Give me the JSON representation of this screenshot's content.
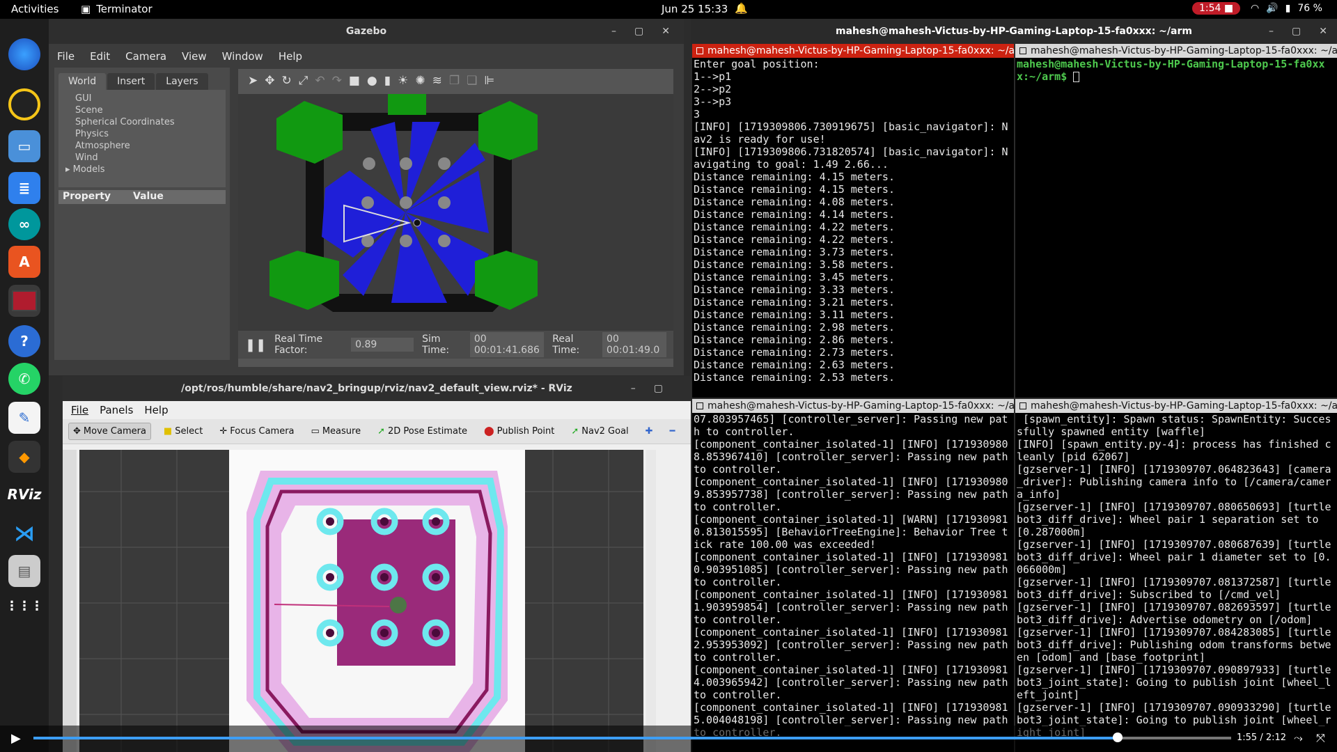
{
  "topbar": {
    "activities": "Activities",
    "app": "Terminator",
    "clock": "Jun 25  15:33",
    "rec": "1:54",
    "battery": "76 %"
  },
  "dock": {
    "items": [
      "firefox-icon",
      "rhythmbox-icon",
      "files-icon",
      "writer-icon",
      "arduino-icon",
      "app-center-icon",
      "terminator-icon",
      "help-icon",
      "whatsapp-icon",
      "text-editor-icon",
      "sublime-icon",
      "rviz-icon",
      "vscode-icon",
      "disk-icon",
      "show-apps-icon"
    ]
  },
  "gazebo": {
    "title": "Gazebo",
    "menu": [
      "File",
      "Edit",
      "Camera",
      "View",
      "Window",
      "Help"
    ],
    "tabs": [
      "World",
      "Insert",
      "Layers"
    ],
    "tree": [
      "GUI",
      "Scene",
      "Spherical Coordinates",
      "Physics",
      "Atmosphere",
      "Wind",
      "Models"
    ],
    "prop_header": "Property",
    "value_header": "Value",
    "rtf_label": "Real Time Factor:",
    "rtf": "0.89",
    "sim_label": "Sim Time:",
    "sim": "00 00:01:41.686",
    "real_label": "Real Time:",
    "real": "00 00:01:49.0"
  },
  "rviz": {
    "title": "/opt/ros/humble/share/nav2_bringup/rviz/nav2_default_view.rviz* - RViz",
    "menu": [
      "File",
      "Panels",
      "Help"
    ],
    "tools": [
      "Move Camera",
      "Select",
      "Focus Camera",
      "Measure",
      "2D Pose Estimate",
      "Publish Point",
      "Nav2 Goal"
    ]
  },
  "terminal": {
    "window_title": "mahesh@mahesh-Victus-by-HP-Gaming-Laptop-15-fa0xxx: ~/arm",
    "pane1_title": "mahesh@mahesh-Victus-by-HP-Gaming-Laptop-15-fa0xxx: ~/arm",
    "pane1": "Enter goal position:\n1-->p1\n2-->p2\n3-->p3\n3\n[INFO] [1719309806.730919675] [basic_navigator]: Nav2 is ready for use!\n[INFO] [1719309806.731820574] [basic_navigator]: Navigating to goal: 1.49 2.66...\nDistance remaining: 4.15 meters.\nDistance remaining: 4.15 meters.\nDistance remaining: 4.08 meters.\nDistance remaining: 4.14 meters.\nDistance remaining: 4.22 meters.\nDistance remaining: 4.22 meters.\nDistance remaining: 3.73 meters.\nDistance remaining: 3.58 meters.\nDistance remaining: 3.45 meters.\nDistance remaining: 3.33 meters.\nDistance remaining: 3.21 meters.\nDistance remaining: 3.11 meters.\nDistance remaining: 2.98 meters.\nDistance remaining: 2.86 meters.\nDistance remaining: 2.73 meters.\nDistance remaining: 2.63 meters.\nDistance remaining: 2.53 meters.",
    "pane2_title": "mahesh@mahesh-Victus-by-HP-Gaming-Laptop-15-fa0xxx: ~/arm",
    "pane2_prompt": "mahesh@mahesh-Victus-by-HP-Gaming-Laptop-15-fa0xxx:~/arm$ ",
    "pane3_title": "mahesh@mahesh-Victus-by-HP-Gaming-Laptop-15-fa0xxx: ~/arm",
    "pane3": "07.803957465] [controller_server]: Passing new path to controller.\n[component_container_isolated-1] [INFO] [1719309808.853967410] [controller_server]: Passing new path to controller.\n[component_container_isolated-1] [INFO] [1719309809.853957738] [controller_server]: Passing new path to controller.\n[component_container_isolated-1] [WARN] [1719309810.813015595] [BehaviorTreeEngine]: Behavior Tree tick rate 100.00 was exceeded!\n[component_container_isolated-1] [INFO] [1719309810.903951085] [controller_server]: Passing new path to controller.\n[component_container_isolated-1] [INFO] [1719309811.903959854] [controller_server]: Passing new path to controller.\n[component_container_isolated-1] [INFO] [1719309812.953953092] [controller_server]: Passing new path to controller.\n[component_container_isolated-1] [INFO] [1719309814.003965942] [controller_server]: Passing new path to controller.\n[component_container_isolated-1] [INFO] [1719309815.004048198] [controller_server]: Passing new path to controller.",
    "pane4_title": "mahesh@mahesh-Victus-by-HP-Gaming-Laptop-15-fa0xxx: ~/arm",
    "pane4": " [spawn_entity]: Spawn status: SpawnEntity: Successfully spawned entity [waffle]\n[INFO] [spawn_entity.py-4]: process has finished cleanly [pid 62067]\n[gzserver-1] [INFO] [1719309707.064823643] [camera_driver]: Publishing camera info to [/camera/camera_info]\n[gzserver-1] [INFO] [1719309707.080650693] [turtlebot3_diff_drive]: Wheel pair 1 separation set to [0.287000m]\n[gzserver-1] [INFO] [1719309707.080687639] [turtlebot3_diff_drive]: Wheel pair 1 diameter set to [0.066000m]\n[gzserver-1] [INFO] [1719309707.081372587] [turtlebot3_diff_drive]: Subscribed to [/cmd_vel]\n[gzserver-1] [INFO] [1719309707.082693597] [turtlebot3_diff_drive]: Advertise odometry on [/odom]\n[gzserver-1] [INFO] [1719309707.084283085] [turtlebot3_diff_drive]: Publishing odom transforms between [odom] and [base_footprint]\n[gzserver-1] [INFO] [1719309707.090897933] [turtlebot3_joint_state]: Going to publish joint [wheel_left_joint]\n[gzserver-1] [INFO] [1719309707.090933290] [turtlebot3_joint_state]: Going to publish joint [wheel_right_joint]"
  },
  "video": {
    "time": "1:55 / 2:12",
    "progress": 0.905
  }
}
